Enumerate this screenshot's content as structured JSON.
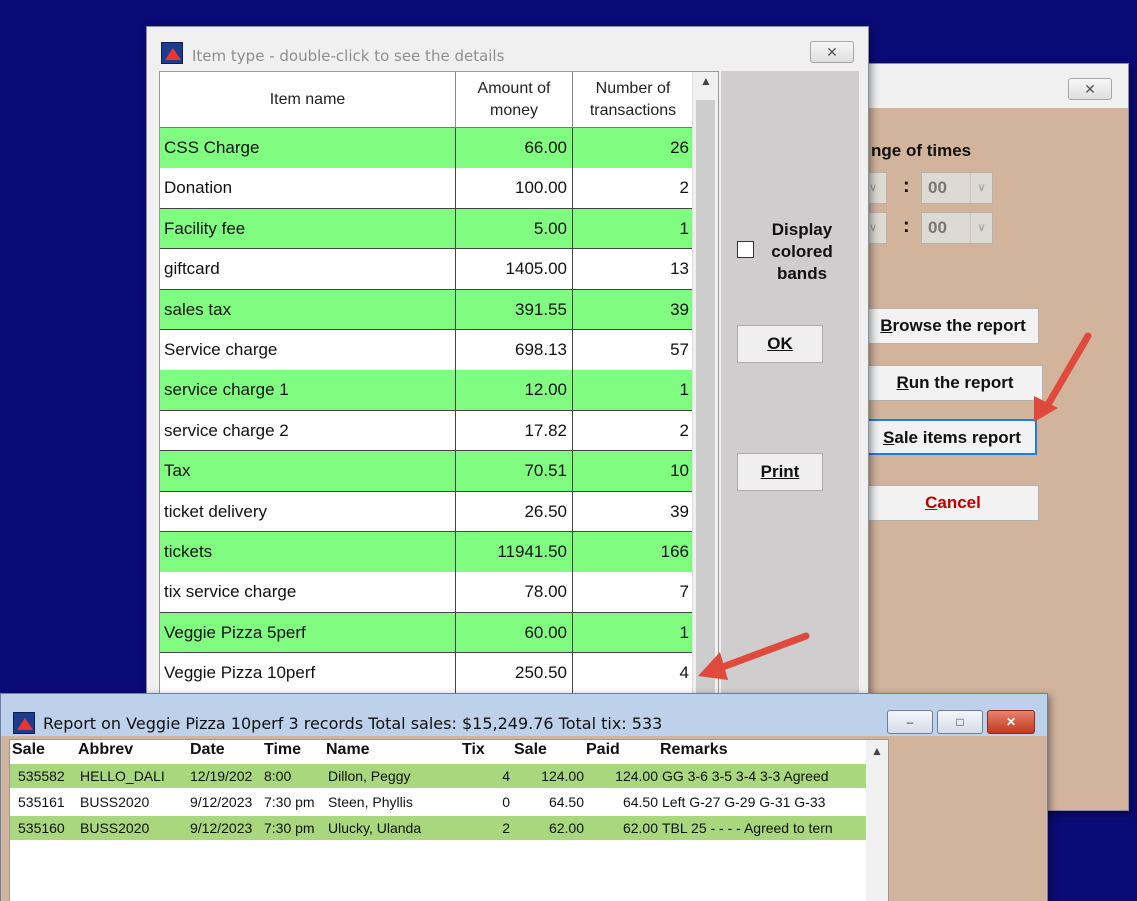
{
  "back_window": {
    "range_label": "nge of times",
    "time1_value": "00",
    "time2_value": "00",
    "colon": ":",
    "dropdown_glyph": "∨",
    "buttons": {
      "browse": "Browse the report",
      "run": "Run the report",
      "sale_items": "Sale items report",
      "cancel": "Cancel"
    },
    "close_glyph": "✕"
  },
  "item_window": {
    "title": "Item type - double-click to see the details",
    "close_glyph": "✕",
    "columns": {
      "name": "Item name",
      "money": "Amount of money",
      "count": "Number of transactions"
    },
    "rows": [
      {
        "name": "CSS Charge",
        "money": "66.00",
        "count": "26",
        "band": "green"
      },
      {
        "name": "Donation",
        "money": "100.00",
        "count": "2",
        "band": "white"
      },
      {
        "name": "Facility fee",
        "money": "5.00",
        "count": "1",
        "band": "green"
      },
      {
        "name": "giftcard",
        "money": "1405.00",
        "count": "13",
        "band": "white"
      },
      {
        "name": "sales tax",
        "money": "391.55",
        "count": "39",
        "band": "green"
      },
      {
        "name": "Service charge",
        "money": "698.13",
        "count": "57",
        "band": "white"
      },
      {
        "name": "service charge 1",
        "money": "12.00",
        "count": "1",
        "band": "green"
      },
      {
        "name": "service charge 2",
        "money": "17.82",
        "count": "2",
        "band": "white"
      },
      {
        "name": "Tax",
        "money": "70.51",
        "count": "10",
        "band": "green"
      },
      {
        "name": "ticket delivery",
        "money": "26.50",
        "count": "39",
        "band": "white"
      },
      {
        "name": "tickets",
        "money": "11941.50",
        "count": "166",
        "band": "green"
      },
      {
        "name": "tix service charge",
        "money": "78.00",
        "count": "7",
        "band": "white"
      },
      {
        "name": "Veggie Pizza  5perf",
        "money": "60.00",
        "count": "1",
        "band": "green"
      },
      {
        "name": "Veggie Pizza 10perf",
        "money": "250.50",
        "count": "4",
        "band": "white"
      }
    ],
    "display_colored_bands": "Display colored bands",
    "ok_label": "OK",
    "print_label": "Print",
    "scroll_up_glyph": "▲"
  },
  "report_window": {
    "title": "Report on Veggie Pizza 10perf      3 records   Total sales: $15,249.76  Total tix: 533",
    "columns": [
      "Sale",
      "Abbrev",
      "Date",
      "Time",
      "Name",
      "Tix",
      "Sale",
      "Paid",
      "Remarks"
    ],
    "rows": [
      {
        "sale": "535582",
        "abbrev": "HELLO_DALI",
        "date": "12/19/202",
        "time": "8:00",
        "name": "Dillon, Peggy",
        "tix": "4",
        "amount": "124.00",
        "paid": "124.00",
        "remarks": "GG 3-6 3-5 3-4 3-3 Agreed",
        "band": "green"
      },
      {
        "sale": "535161",
        "abbrev": "BUSS2020",
        "date": "9/12/2023",
        "time": "7:30 pm",
        "name": "Steen, Phyllis",
        "tix": "0",
        "amount": "64.50",
        "paid": "64.50",
        "remarks": "Left G-27 G-29 G-31 G-33",
        "band": "white"
      },
      {
        "sale": "535160",
        "abbrev": "BUSS2020",
        "date": "9/12/2023",
        "time": "7:30 pm",
        "name": "Ulucky, Ulanda",
        "tix": "2",
        "amount": "62.00",
        "paid": "62.00",
        "remarks": "TBL 25 - - - - Agreed to tern",
        "band": "green"
      }
    ],
    "minimize_glyph": "–",
    "maximize_glyph": "□",
    "close_glyph": "✕",
    "scroll_up_glyph": "▲"
  },
  "colors": {
    "desktop": "#0b0b78",
    "band_green": "#80fc80",
    "report_green": "#a9d77e",
    "panel_tan": "#d2b49c",
    "cancel_red": "#c00000",
    "arrow_red": "#e04a3c"
  }
}
